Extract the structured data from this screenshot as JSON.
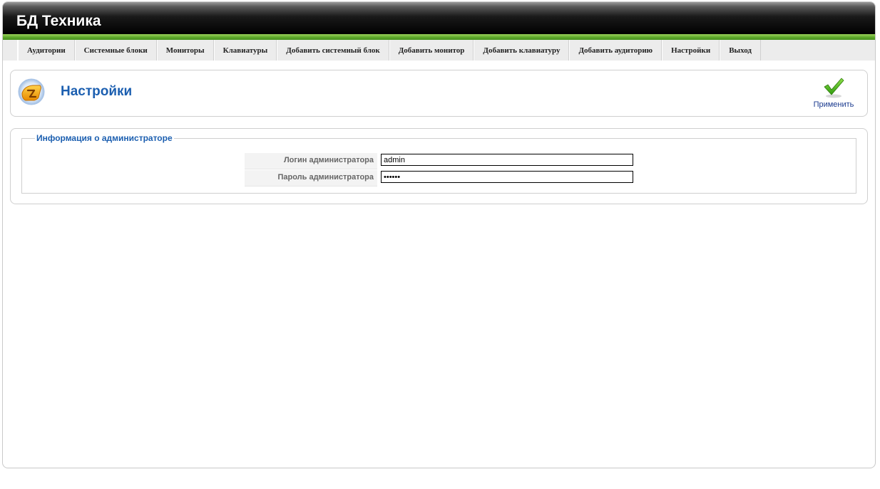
{
  "app": {
    "title": "БД Техника"
  },
  "nav": {
    "items": [
      "Аудитории",
      "Системные блоки",
      "Мониторы",
      "Клавиатуры",
      "Добавить системный блок",
      "Добавить монитор",
      "Добавить клавиатуру",
      "Добавить аудиторию",
      "Настройки",
      "Выход"
    ]
  },
  "toolbar": {
    "page_title": "Настройки",
    "page_icon": "settings-icon",
    "apply_label": "Применить",
    "apply_icon": "checkmark-icon"
  },
  "form": {
    "legend": "Информация о администраторе",
    "login_label": "Логин администратора",
    "login_value": "admin",
    "password_label": "Пароль администратора",
    "password_value": "••••••"
  },
  "colors": {
    "accent_blue": "#1c5fb0",
    "header_green": "#5aa528",
    "header_black": "#000000"
  }
}
